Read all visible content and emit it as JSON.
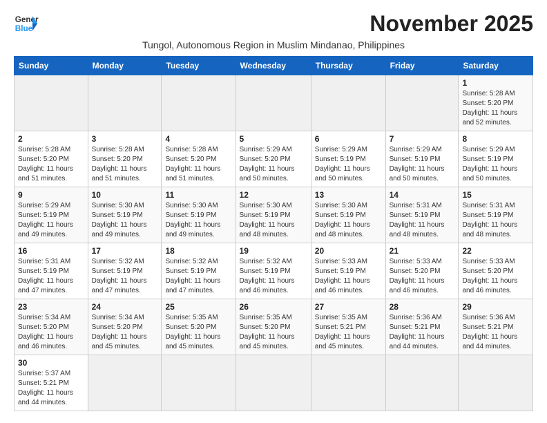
{
  "header": {
    "logo_general": "General",
    "logo_blue": "Blue",
    "month_title": "November 2025",
    "subtitle": "Tungol, Autonomous Region in Muslim Mindanao, Philippines"
  },
  "weekdays": [
    "Sunday",
    "Monday",
    "Tuesday",
    "Wednesday",
    "Thursday",
    "Friday",
    "Saturday"
  ],
  "weeks": [
    [
      {
        "day": "",
        "sunrise": "",
        "sunset": "",
        "daylight": ""
      },
      {
        "day": "",
        "sunrise": "",
        "sunset": "",
        "daylight": ""
      },
      {
        "day": "",
        "sunrise": "",
        "sunset": "",
        "daylight": ""
      },
      {
        "day": "",
        "sunrise": "",
        "sunset": "",
        "daylight": ""
      },
      {
        "day": "",
        "sunrise": "",
        "sunset": "",
        "daylight": ""
      },
      {
        "day": "",
        "sunrise": "",
        "sunset": "",
        "daylight": ""
      },
      {
        "day": "1",
        "sunrise": "Sunrise: 5:28 AM",
        "sunset": "Sunset: 5:20 PM",
        "daylight": "Daylight: 11 hours and 52 minutes."
      }
    ],
    [
      {
        "day": "2",
        "sunrise": "Sunrise: 5:28 AM",
        "sunset": "Sunset: 5:20 PM",
        "daylight": "Daylight: 11 hours and 51 minutes."
      },
      {
        "day": "3",
        "sunrise": "Sunrise: 5:28 AM",
        "sunset": "Sunset: 5:20 PM",
        "daylight": "Daylight: 11 hours and 51 minutes."
      },
      {
        "day": "4",
        "sunrise": "Sunrise: 5:28 AM",
        "sunset": "Sunset: 5:20 PM",
        "daylight": "Daylight: 11 hours and 51 minutes."
      },
      {
        "day": "5",
        "sunrise": "Sunrise: 5:29 AM",
        "sunset": "Sunset: 5:20 PM",
        "daylight": "Daylight: 11 hours and 50 minutes."
      },
      {
        "day": "6",
        "sunrise": "Sunrise: 5:29 AM",
        "sunset": "Sunset: 5:19 PM",
        "daylight": "Daylight: 11 hours and 50 minutes."
      },
      {
        "day": "7",
        "sunrise": "Sunrise: 5:29 AM",
        "sunset": "Sunset: 5:19 PM",
        "daylight": "Daylight: 11 hours and 50 minutes."
      },
      {
        "day": "8",
        "sunrise": "Sunrise: 5:29 AM",
        "sunset": "Sunset: 5:19 PM",
        "daylight": "Daylight: 11 hours and 50 minutes."
      }
    ],
    [
      {
        "day": "9",
        "sunrise": "Sunrise: 5:29 AM",
        "sunset": "Sunset: 5:19 PM",
        "daylight": "Daylight: 11 hours and 49 minutes."
      },
      {
        "day": "10",
        "sunrise": "Sunrise: 5:30 AM",
        "sunset": "Sunset: 5:19 PM",
        "daylight": "Daylight: 11 hours and 49 minutes."
      },
      {
        "day": "11",
        "sunrise": "Sunrise: 5:30 AM",
        "sunset": "Sunset: 5:19 PM",
        "daylight": "Daylight: 11 hours and 49 minutes."
      },
      {
        "day": "12",
        "sunrise": "Sunrise: 5:30 AM",
        "sunset": "Sunset: 5:19 PM",
        "daylight": "Daylight: 11 hours and 48 minutes."
      },
      {
        "day": "13",
        "sunrise": "Sunrise: 5:30 AM",
        "sunset": "Sunset: 5:19 PM",
        "daylight": "Daylight: 11 hours and 48 minutes."
      },
      {
        "day": "14",
        "sunrise": "Sunrise: 5:31 AM",
        "sunset": "Sunset: 5:19 PM",
        "daylight": "Daylight: 11 hours and 48 minutes."
      },
      {
        "day": "15",
        "sunrise": "Sunrise: 5:31 AM",
        "sunset": "Sunset: 5:19 PM",
        "daylight": "Daylight: 11 hours and 48 minutes."
      }
    ],
    [
      {
        "day": "16",
        "sunrise": "Sunrise: 5:31 AM",
        "sunset": "Sunset: 5:19 PM",
        "daylight": "Daylight: 11 hours and 47 minutes."
      },
      {
        "day": "17",
        "sunrise": "Sunrise: 5:32 AM",
        "sunset": "Sunset: 5:19 PM",
        "daylight": "Daylight: 11 hours and 47 minutes."
      },
      {
        "day": "18",
        "sunrise": "Sunrise: 5:32 AM",
        "sunset": "Sunset: 5:19 PM",
        "daylight": "Daylight: 11 hours and 47 minutes."
      },
      {
        "day": "19",
        "sunrise": "Sunrise: 5:32 AM",
        "sunset": "Sunset: 5:19 PM",
        "daylight": "Daylight: 11 hours and 46 minutes."
      },
      {
        "day": "20",
        "sunrise": "Sunrise: 5:33 AM",
        "sunset": "Sunset: 5:19 PM",
        "daylight": "Daylight: 11 hours and 46 minutes."
      },
      {
        "day": "21",
        "sunrise": "Sunrise: 5:33 AM",
        "sunset": "Sunset: 5:20 PM",
        "daylight": "Daylight: 11 hours and 46 minutes."
      },
      {
        "day": "22",
        "sunrise": "Sunrise: 5:33 AM",
        "sunset": "Sunset: 5:20 PM",
        "daylight": "Daylight: 11 hours and 46 minutes."
      }
    ],
    [
      {
        "day": "23",
        "sunrise": "Sunrise: 5:34 AM",
        "sunset": "Sunset: 5:20 PM",
        "daylight": "Daylight: 11 hours and 46 minutes."
      },
      {
        "day": "24",
        "sunrise": "Sunrise: 5:34 AM",
        "sunset": "Sunset: 5:20 PM",
        "daylight": "Daylight: 11 hours and 45 minutes."
      },
      {
        "day": "25",
        "sunrise": "Sunrise: 5:35 AM",
        "sunset": "Sunset: 5:20 PM",
        "daylight": "Daylight: 11 hours and 45 minutes."
      },
      {
        "day": "26",
        "sunrise": "Sunrise: 5:35 AM",
        "sunset": "Sunset: 5:20 PM",
        "daylight": "Daylight: 11 hours and 45 minutes."
      },
      {
        "day": "27",
        "sunrise": "Sunrise: 5:35 AM",
        "sunset": "Sunset: 5:21 PM",
        "daylight": "Daylight: 11 hours and 45 minutes."
      },
      {
        "day": "28",
        "sunrise": "Sunrise: 5:36 AM",
        "sunset": "Sunset: 5:21 PM",
        "daylight": "Daylight: 11 hours and 44 minutes."
      },
      {
        "day": "29",
        "sunrise": "Sunrise: 5:36 AM",
        "sunset": "Sunset: 5:21 PM",
        "daylight": "Daylight: 11 hours and 44 minutes."
      }
    ],
    [
      {
        "day": "30",
        "sunrise": "Sunrise: 5:37 AM",
        "sunset": "Sunset: 5:21 PM",
        "daylight": "Daylight: 11 hours and 44 minutes."
      },
      {
        "day": "",
        "sunrise": "",
        "sunset": "",
        "daylight": ""
      },
      {
        "day": "",
        "sunrise": "",
        "sunset": "",
        "daylight": ""
      },
      {
        "day": "",
        "sunrise": "",
        "sunset": "",
        "daylight": ""
      },
      {
        "day": "",
        "sunrise": "",
        "sunset": "",
        "daylight": ""
      },
      {
        "day": "",
        "sunrise": "",
        "sunset": "",
        "daylight": ""
      },
      {
        "day": "",
        "sunrise": "",
        "sunset": "",
        "daylight": ""
      }
    ]
  ]
}
